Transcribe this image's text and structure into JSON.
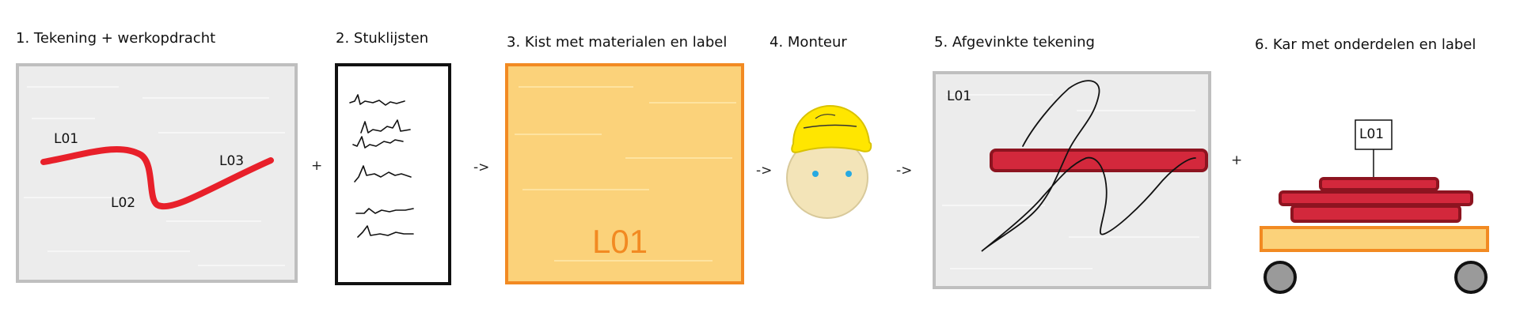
{
  "steps": [
    {
      "title": "1. Tekening + werkopdracht"
    },
    {
      "title": "2. Stuklijsten"
    },
    {
      "title": "3. Kist met materialen en label"
    },
    {
      "title": "4. Monteur"
    },
    {
      "title": "5. Afgevinkte tekening"
    },
    {
      "title": "6. Kar met onderdelen en label"
    }
  ],
  "separators": [
    "+",
    "->",
    "->",
    "->",
    "+"
  ],
  "drawing_labels": {
    "l01": "L01",
    "l02": "L02",
    "l03": "L03"
  },
  "crate_label": "L01",
  "checked_drawing_label": "L01",
  "cart_label": "L01",
  "colors": {
    "drawing_line": "#e8202a",
    "crate_fill": "#fbd27a",
    "crate_border": "#f28a22",
    "crate_text": "#f28a22",
    "part_red": "#d3283c",
    "helmet": "#ffe600",
    "face": "#f3e4b8",
    "eyes": "#27a9e1"
  }
}
